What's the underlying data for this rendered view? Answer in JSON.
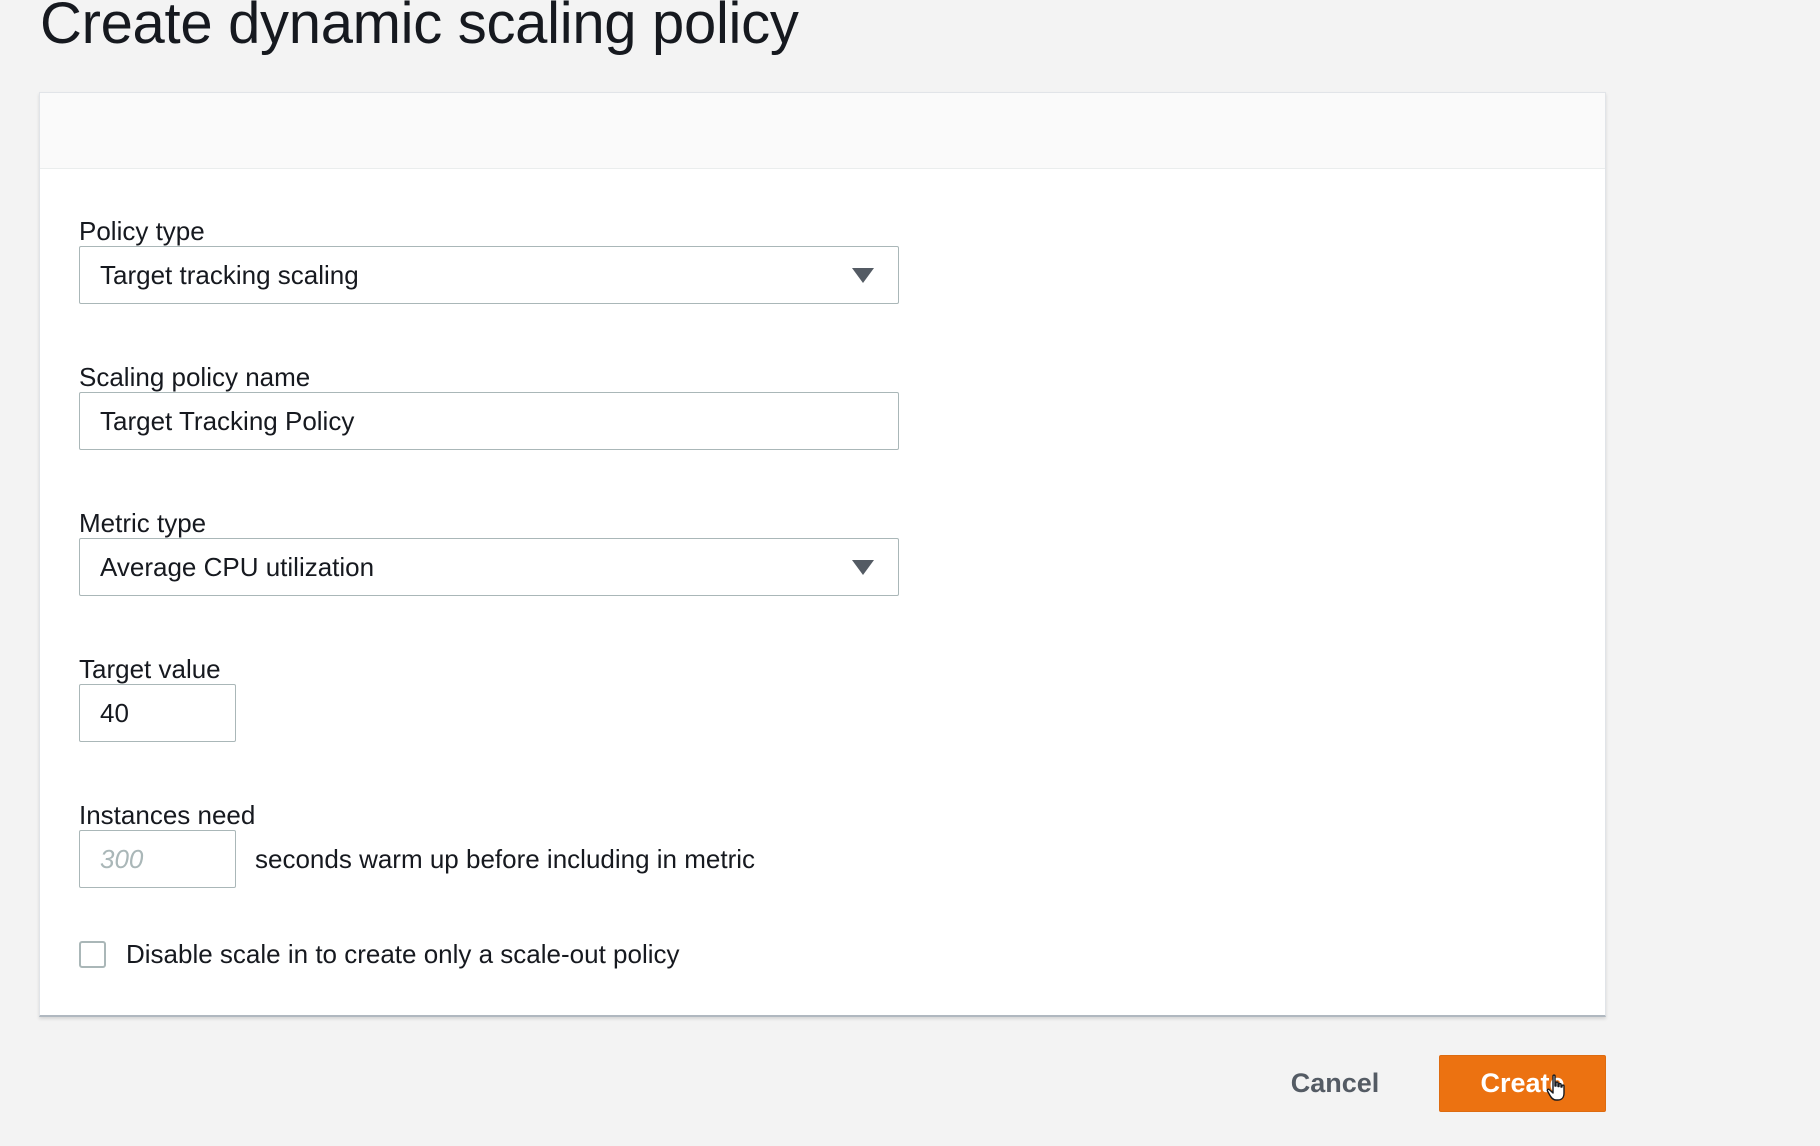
{
  "page": {
    "title": "Create dynamic scaling policy"
  },
  "form": {
    "policy_type": {
      "label": "Policy type",
      "value": "Target tracking scaling",
      "icon": "chevron-down-icon"
    },
    "policy_name": {
      "label": "Scaling policy name",
      "value": "Target Tracking Policy"
    },
    "metric_type": {
      "label": "Metric type",
      "value": "Average CPU utilization",
      "icon": "chevron-down-icon"
    },
    "target_value": {
      "label": "Target value",
      "value": "40"
    },
    "warmup": {
      "label": "Instances need",
      "placeholder": "300",
      "suffix": "seconds warm up before including in metric"
    },
    "disable_scale_in": {
      "label": "Disable scale in to create only a scale-out policy",
      "checked": false
    }
  },
  "actions": {
    "cancel_label": "Cancel",
    "create_label": "Create"
  },
  "colors": {
    "primary_button": "#ec7211",
    "background": "#f3f3f3",
    "text": "#16191f"
  }
}
